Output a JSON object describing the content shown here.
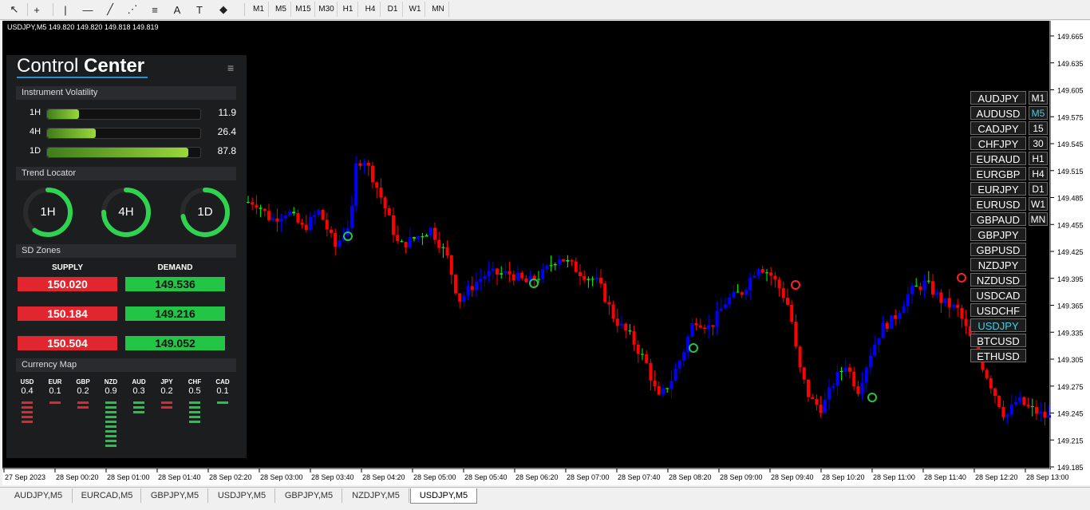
{
  "toolbar": {
    "tools": [
      {
        "name": "cursor-icon",
        "glyph": "↖"
      },
      {
        "name": "crosshair-icon",
        "glyph": "+"
      },
      {
        "name": "vertical-line-icon",
        "glyph": "|"
      },
      {
        "name": "horizontal-line-icon",
        "glyph": "—"
      },
      {
        "name": "trend-line-icon",
        "glyph": "╱"
      },
      {
        "name": "fibonacci-fan-icon",
        "glyph": "⋰"
      },
      {
        "name": "fibonacci-retracement-icon",
        "glyph": "≡"
      },
      {
        "name": "text-icon",
        "glyph": "A"
      },
      {
        "name": "text-label-icon",
        "glyph": "T"
      },
      {
        "name": "shapes-icon",
        "glyph": "◆"
      }
    ],
    "timeframes": [
      "M1",
      "M5",
      "M15",
      "M30",
      "H1",
      "H4",
      "D1",
      "W1",
      "MN"
    ]
  },
  "chart": {
    "symbol_info": "USDJPY,M5  149.820 149.820 149.818 149.819",
    "price_labels": [
      "149.665",
      "149.635",
      "149.605",
      "149.575",
      "149.545",
      "149.515",
      "149.485",
      "149.455",
      "149.425",
      "149.395",
      "149.365",
      "149.335",
      "149.305",
      "149.275",
      "149.245",
      "149.215",
      "149.185"
    ],
    "time_labels": [
      "27 Sep 2023",
      "28 Sep 00:20",
      "28 Sep 01:00",
      "28 Sep 01:40",
      "28 Sep 02:20",
      "28 Sep 03:00",
      "28 Sep 03:40",
      "28 Sep 04:20",
      "28 Sep 05:00",
      "28 Sep 05:40",
      "28 Sep 06:20",
      "28 Sep 07:00",
      "28 Sep 07:40",
      "28 Sep 08:20",
      "28 Sep 09:00",
      "28 Sep 09:40",
      "28 Sep 10:20",
      "28 Sep 11:00",
      "28 Sep 11:40",
      "28 Sep 12:20",
      "28 Sep 13:00"
    ],
    "colors": {
      "bull": "#0000ff",
      "bear": "#ff0000",
      "doji": "#00ff00",
      "background": "#000000",
      "grid_text": "#000000"
    }
  },
  "panel": {
    "title_light": "Control ",
    "title_bold": "Center",
    "menu_glyph": "≡",
    "volatility": {
      "header": "Instrument Volatility",
      "rows": [
        {
          "label": "1H",
          "value": "11.9",
          "level": 0.21
        },
        {
          "label": "4H",
          "value": "26.4",
          "level": 0.32
        },
        {
          "label": "1D",
          "value": "87.8",
          "level": 0.92
        }
      ]
    },
    "trend": {
      "header": "Trend Locator",
      "gauges": [
        {
          "label": "1H",
          "level": 0.6
        },
        {
          "label": "4H",
          "level": 0.75
        },
        {
          "label": "1D",
          "level": 0.72
        }
      ]
    },
    "sd": {
      "header": "SD Zones",
      "supply_label": "SUPPLY",
      "demand_label": "DEMAND",
      "supply": [
        "150.020",
        "150.184",
        "150.504"
      ],
      "demand": [
        "149.536",
        "149.216",
        "149.052"
      ]
    },
    "currency_map": {
      "header": "Currency Map",
      "items": [
        {
          "code": "USD",
          "value": "0.4",
          "bars": 5,
          "color": "#e1262f"
        },
        {
          "code": "EUR",
          "value": "0.1",
          "bars": 1,
          "color": "#e1262f"
        },
        {
          "code": "GBP",
          "value": "0.2",
          "bars": 2,
          "color": "#e1262f"
        },
        {
          "code": "NZD",
          "value": "0.9",
          "bars": 10,
          "color": "#22c545"
        },
        {
          "code": "AUD",
          "value": "0.3",
          "bars": 3,
          "color": "#22c545"
        },
        {
          "code": "JPY",
          "value": "0.2",
          "bars": 2,
          "color": "#e1262f"
        },
        {
          "code": "CHF",
          "value": "0.5",
          "bars": 5,
          "color": "#22c545"
        },
        {
          "code": "CAD",
          "value": "0.1",
          "bars": 1,
          "color": "#22c545"
        }
      ]
    }
  },
  "symbols": [
    "AUDJPY",
    "AUDUSD",
    "CADJPY",
    "CHFJPY",
    "EURAUD",
    "EURGBP",
    "EURJPY",
    "EURUSD",
    "GBPAUD",
    "GBPJPY",
    "GBPUSD",
    "NZDJPY",
    "NZDUSD",
    "USDCAD",
    "USDCHF",
    "USDJPY",
    "BTCUSD",
    "ETHUSD"
  ],
  "active_symbol": "USDJPY",
  "side_timeframes": [
    "M1",
    "M5",
    "15",
    "30",
    "H1",
    "H4",
    "D1",
    "W1",
    "MN"
  ],
  "active_side_timeframe": "M5",
  "active_color": "#3fd0e6",
  "tabs": [
    "AUDJPY,M5",
    "EURCAD,M5",
    "GBPJPY,M5",
    "USDJPY,M5",
    "GBPJPY,M5",
    "NZDJPY,M5",
    "USDJPY,M5"
  ],
  "active_tab": 6
}
